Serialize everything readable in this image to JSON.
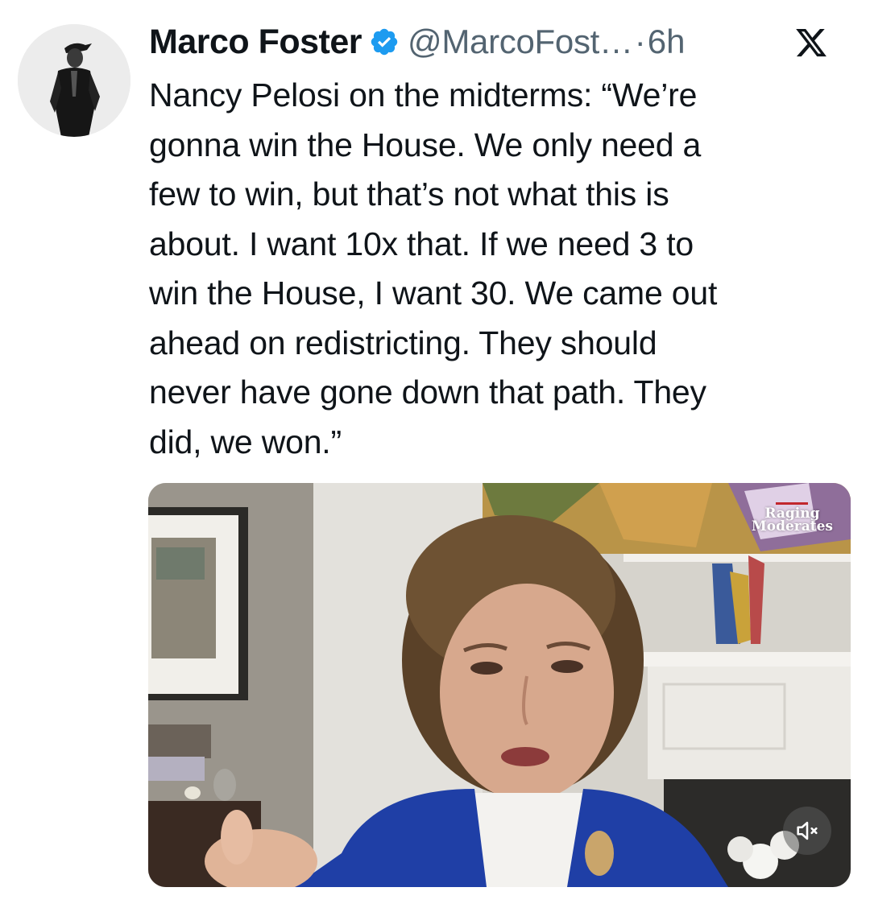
{
  "tweet": {
    "author": {
      "name": "Marco Foster",
      "handle": "@MarcoFost…",
      "verified": true
    },
    "separator": "·",
    "time": "6h",
    "platform_icon": "x-logo-icon",
    "text_lines": [
      "Nancy Pelosi on the midterms: “We’re",
      "gonna win the House. We only need a",
      "few to win, but that’s not what this is",
      "about. I want 10x that. If we need 3 to",
      "win the House, I want 30. We came out",
      "ahead on redistricting. They should",
      "never have gone down that path. They",
      "did, we won.”"
    ],
    "media": {
      "type": "video",
      "watermark": {
        "line1": "Raging",
        "line2": "Moderates"
      },
      "mute_icon": "speaker-muted-icon"
    }
  },
  "colors": {
    "text_primary": "#0f1419",
    "text_secondary": "#536471",
    "verified_blue": "#1d9bf0",
    "jacket_blue": "#1f3fa6"
  }
}
